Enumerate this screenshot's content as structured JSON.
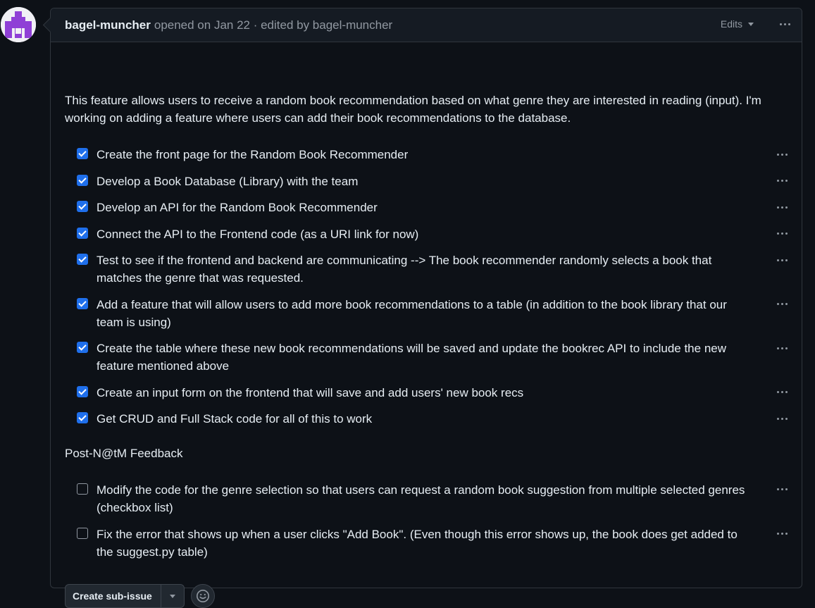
{
  "header": {
    "author": "bagel-muncher",
    "meta": "opened on Jan 22 · edited by bagel-muncher",
    "edits_label": "Edits"
  },
  "body": {
    "intro": "This feature allows users to receive a random book recommendation based on what genre they are interested in reading (input). I'm working on adding a feature where users can add their book recommendations to the database.",
    "tasks": [
      {
        "checked": true,
        "text": "Create the front page for the Random Book Recommender"
      },
      {
        "checked": true,
        "text": "Develop a Book Database (Library) with the team"
      },
      {
        "checked": true,
        "text": "Develop an API for the Random Book Recommender"
      },
      {
        "checked": true,
        "text": "Connect the API to the Frontend code (as a URI link for now)"
      },
      {
        "checked": true,
        "text": "Test to see if the frontend and backend are communicating --> The book recommender randomly selects a book that matches the genre that was requested."
      },
      {
        "checked": true,
        "text": "Add a feature that will allow users to add more book recommendations to a table (in addition to the book library that our team is using)"
      },
      {
        "checked": true,
        "text": "Create the table where these new book recommendations will be saved and update the bookrec API to include the new feature mentioned above"
      },
      {
        "checked": true,
        "text": "Create an input form on the frontend that will save and add users' new book recs"
      },
      {
        "checked": true,
        "text": "Get CRUD and Full Stack code for all of this to work"
      }
    ],
    "section_heading": "Post-N@tM Feedback",
    "feedback_tasks": [
      {
        "checked": false,
        "text": "Modify the code for the genre selection so that users can request a random book suggestion from multiple selected genres (checkbox list)"
      },
      {
        "checked": false,
        "text": "Fix the error that shows up when a user clicks \"Add Book\". (Even though this error shows up, the book does get added to the suggest.py table)"
      }
    ]
  },
  "footer": {
    "create_sub_issue_label": "Create sub-issue"
  },
  "icons": {
    "avatar": "identicon-avatar",
    "kebab": "kebab-horizontal-icon",
    "caret": "triangle-down-icon",
    "emoji": "smiley-icon"
  },
  "colors": {
    "background": "#0d1117",
    "header_bg": "#151b23",
    "border": "#30363d",
    "checkbox_accent": "#1f6feb",
    "muted_text": "#9198a1",
    "text": "#e6edf3",
    "avatar_fg": "#8f3fd6"
  }
}
